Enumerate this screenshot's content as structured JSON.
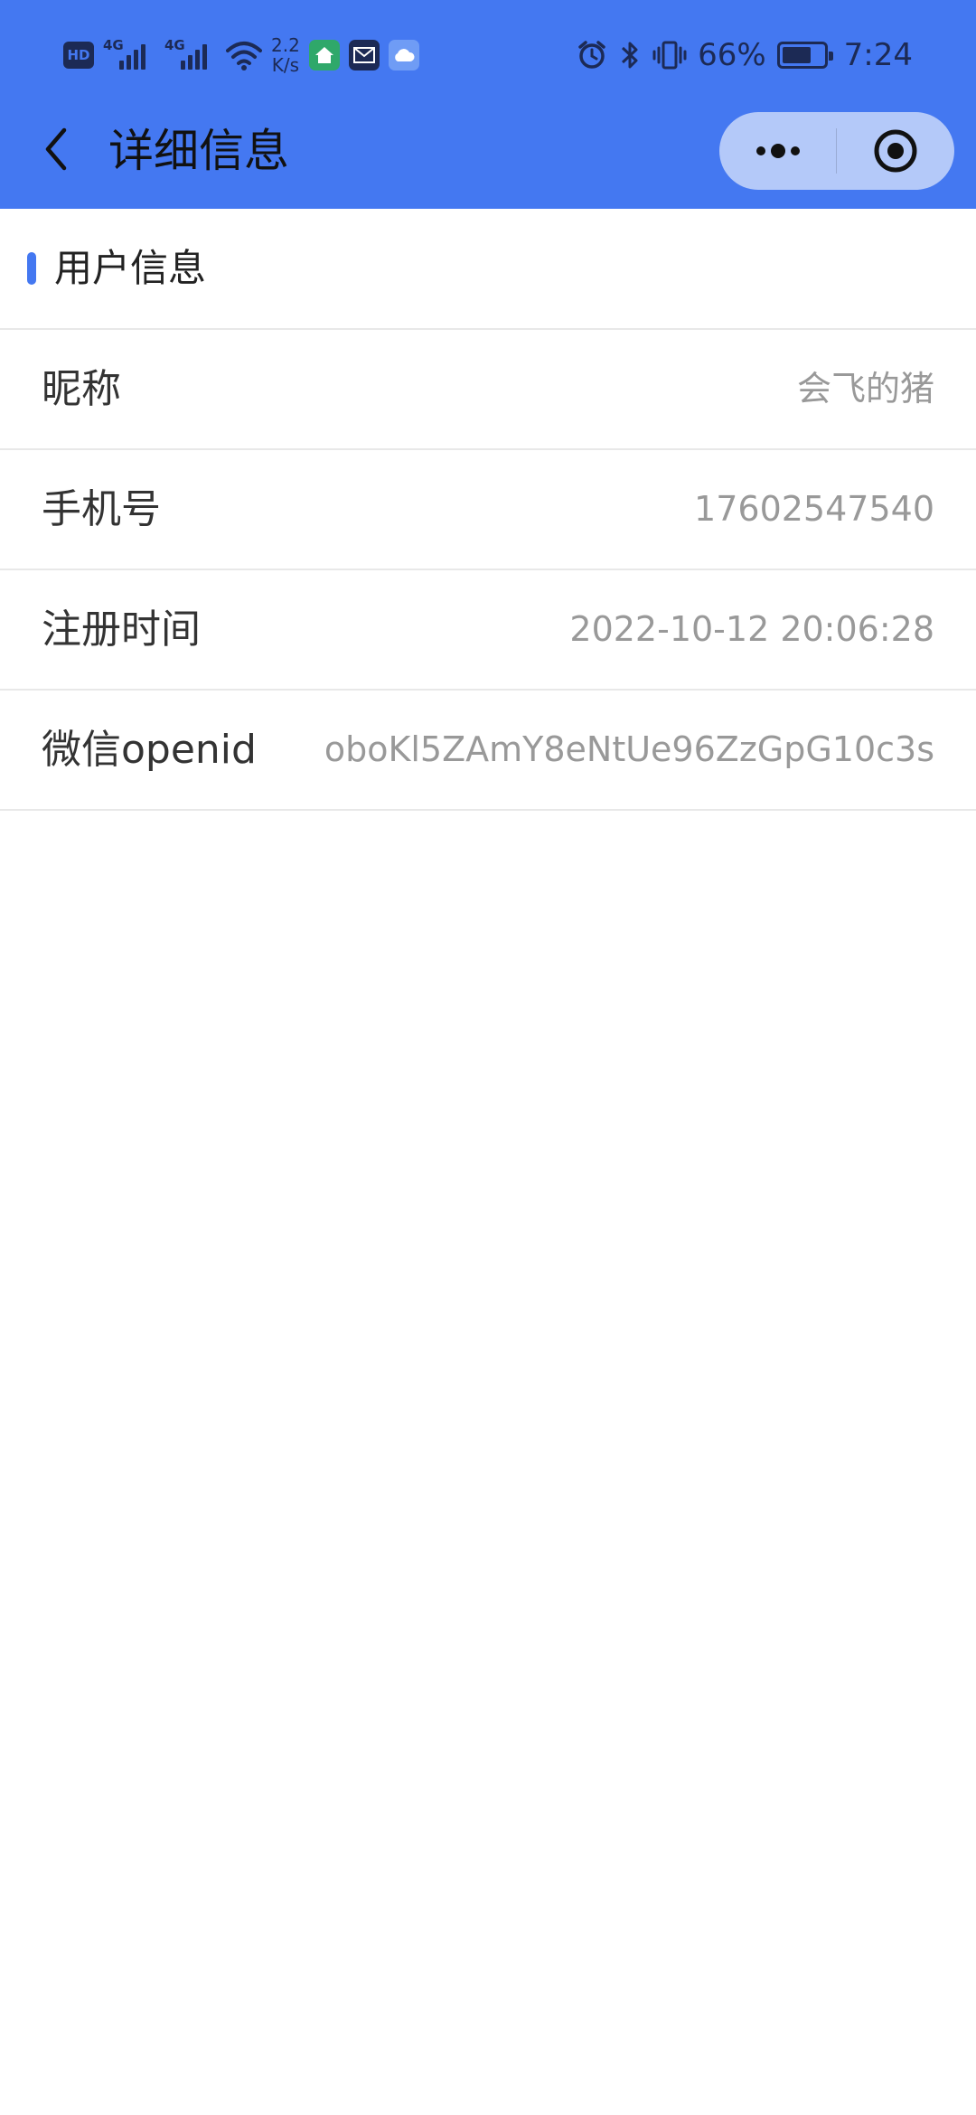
{
  "status_bar": {
    "network_speed_value": "2.2",
    "network_speed_unit": "K/s",
    "signal_1": "4G",
    "signal_2": "4G",
    "battery": "66%",
    "time": "7:24"
  },
  "nav": {
    "title": "详细信息"
  },
  "section": {
    "title": "用户信息"
  },
  "rows": [
    {
      "label": "昵称",
      "value": "会飞的猪"
    },
    {
      "label": "手机号",
      "value": "17602547540"
    },
    {
      "label": "注册时间",
      "value": "2022-10-12 20:06:28"
    },
    {
      "label": "微信openid",
      "value": "oboKl5ZAmY8eNtUe96ZzGpG10c3s"
    }
  ],
  "colors": {
    "accent": "#4478F1",
    "label_text": "#333333",
    "value_text": "#999999",
    "divider": "#e8e8e8"
  }
}
